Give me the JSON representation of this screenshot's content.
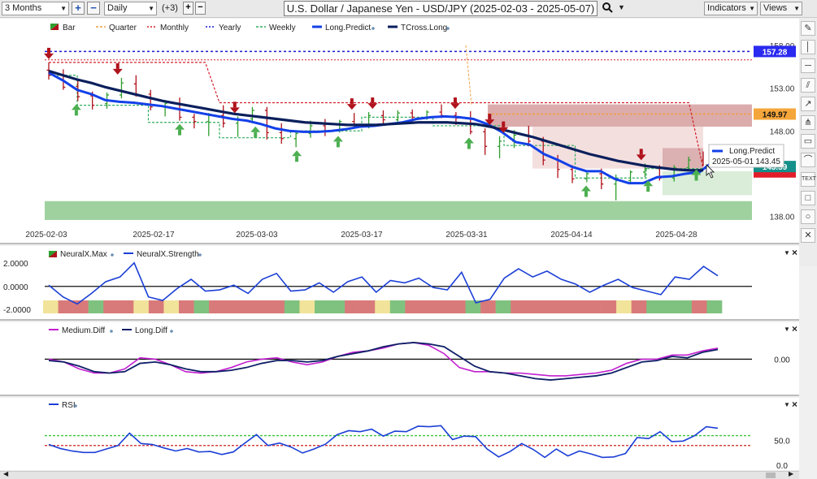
{
  "toolbar": {
    "range": "3 Months",
    "interval": "Daily",
    "plus_count": "(+3)",
    "title": "U.S. Dollar / Japanese Yen - USD/JPY (2025-02-03 - 2025-05-07)",
    "indicators_label": "Indicators",
    "views_label": "Views"
  },
  "legend": {
    "bar": "Bar",
    "quarter": "Quarter",
    "monthly": "Monthly",
    "yearly": "Yearly",
    "weekly": "Weekly",
    "long_predict": "Long.Predict",
    "tcross_long": "TCross.Long"
  },
  "colors": {
    "tcross": "#0a1f5c",
    "predict": "#1340e8",
    "up": "#2e9e2e",
    "down": "#b0121b",
    "yearly": "#1a1ad0",
    "monthly": "#d0202a",
    "quarter": "#f0a040",
    "weekly": "#2eae5a"
  },
  "tooltip": {
    "name": "Long.Predict",
    "date": "2025-05-01",
    "value": "143.45"
  },
  "price_labels": {
    "yearly": "157.28",
    "quarter": "149.97",
    "predict": "143.59",
    "monthly": "143.59"
  },
  "sidebar_icons": [
    "pencil-icon",
    "vertical-line-icon",
    "horizontal-line-icon",
    "channel-icon",
    "fibonacci-icon",
    "pitchfork-icon",
    "note-icon",
    "arc-icon",
    "text-icon",
    "rectangle-icon",
    "ellipse-icon",
    "close-icon"
  ],
  "sidebar_text": {
    "text_tool": "TEXT"
  },
  "chart_data": [
    {
      "type": "line",
      "title": "U.S. Dollar / Japanese Yen - USD/JPY (2025-02-03 - 2025-05-07)",
      "x_tick_labels": [
        "2025-02-03",
        "2025-02-17",
        "2025-03-03",
        "2025-03-17",
        "2025-03-31",
        "2025-04-14",
        "2025-04-28"
      ],
      "y_ticks": [
        138.0,
        143.0,
        148.0,
        153.0,
        158.0
      ],
      "ylim": [
        137.5,
        159.5
      ],
      "levels": {
        "yearly": 157.28,
        "quarter": 149.97,
        "monthly_recent": 143.59
      },
      "series": [
        {
          "name": "TCross.Long",
          "values": [
            155.0,
            154.5,
            154.0,
            153.6,
            153.1,
            152.7,
            152.3,
            151.9,
            151.5,
            151.2,
            150.9,
            150.6,
            150.3,
            150.0,
            149.8,
            149.6,
            149.4,
            149.2,
            149.0,
            148.9,
            148.8,
            148.7,
            148.7,
            148.7,
            148.8,
            148.9,
            149.0,
            149.0,
            149.0,
            148.9,
            148.8,
            148.5,
            148.1,
            147.7,
            147.3,
            146.8,
            146.3,
            145.8,
            145.3,
            144.9,
            144.5,
            144.2,
            143.9,
            143.7,
            143.5,
            143.4,
            143.4
          ]
        },
        {
          "name": "Long.Predict",
          "values": [
            154.8,
            153.9,
            152.8,
            152.3,
            151.6,
            151.4,
            151.3,
            151.1,
            150.9,
            150.6,
            150.3,
            150.0,
            149.7,
            149.4,
            149.2,
            148.8,
            148.3,
            148.0,
            147.9,
            147.9,
            148.0,
            148.2,
            148.5,
            148.6,
            148.8,
            149.0,
            149.4,
            149.6,
            149.7,
            149.6,
            149.4,
            148.8,
            147.9,
            146.7,
            146.4,
            145.3,
            144.6,
            143.8,
            143.3,
            143.3,
            142.4,
            141.9,
            141.9,
            142.6,
            142.7,
            143.0,
            143.2,
            144.5
          ]
        },
        {
          "name": "Weekly",
          "values": [
            154.5,
            154.5,
            151.0,
            151.0,
            151.0,
            151.0,
            151.0,
            149.0,
            149.0,
            149.0,
            149.0,
            149.0,
            147.2,
            147.2,
            147.2,
            147.2,
            147.2,
            148.0,
            148.0,
            148.0,
            148.0,
            148.0,
            149.6,
            149.6,
            149.6,
            149.6,
            149.6,
            148.6,
            148.6,
            148.6,
            148.6,
            148.6,
            146.3,
            146.3,
            146.3,
            146.3,
            146.3,
            142.5,
            142.5,
            142.5,
            142.5,
            142.5,
            143.6,
            143.6,
            143.6,
            143.6,
            143.6
          ]
        },
        {
          "name": "Monthly",
          "values": [
            156.0,
            156.0,
            156.0,
            156.0,
            156.0,
            156.0,
            156.0,
            156.0,
            156.0,
            156.0,
            156.0,
            156.0,
            151.3,
            151.3,
            151.3,
            151.3,
            151.3,
            151.3,
            151.3,
            151.3,
            151.3,
            151.3,
            151.3,
            151.3,
            151.3,
            151.3,
            151.3,
            151.3,
            151.3,
            151.3,
            151.3,
            151.3,
            151.3,
            151.3,
            151.3,
            151.3,
            151.3,
            151.3,
            151.3,
            151.3,
            151.3,
            151.3,
            151.3,
            151.3,
            151.3,
            151.3,
            143.59
          ]
        }
      ],
      "bars": [
        {
          "o": 155.1,
          "h": 156.0,
          "l": 154.0,
          "c": 154.5
        },
        {
          "o": 154.6,
          "h": 155.2,
          "l": 152.8,
          "c": 153.1
        },
        {
          "o": 153.2,
          "h": 153.9,
          "l": 151.5,
          "c": 152.0
        },
        {
          "o": 152.1,
          "h": 152.6,
          "l": 150.5,
          "c": 151.0
        },
        {
          "o": 151.2,
          "h": 152.5,
          "l": 150.6,
          "c": 152.2
        },
        {
          "o": 152.2,
          "h": 154.2,
          "l": 151.8,
          "c": 153.6
        },
        {
          "o": 153.5,
          "h": 154.5,
          "l": 152.0,
          "c": 152.3
        },
        {
          "o": 152.3,
          "h": 152.8,
          "l": 150.4,
          "c": 150.8
        },
        {
          "o": 150.8,
          "h": 151.6,
          "l": 149.7,
          "c": 151.2
        },
        {
          "o": 151.2,
          "h": 151.9,
          "l": 149.2,
          "c": 149.6
        },
        {
          "o": 149.6,
          "h": 150.0,
          "l": 148.3,
          "c": 149.1
        },
        {
          "o": 149.1,
          "h": 150.1,
          "l": 147.4,
          "c": 149.8
        },
        {
          "o": 149.8,
          "h": 151.0,
          "l": 148.4,
          "c": 148.9
        },
        {
          "o": 148.9,
          "h": 149.7,
          "l": 147.3,
          "c": 149.4
        },
        {
          "o": 149.4,
          "h": 150.8,
          "l": 148.9,
          "c": 150.4
        },
        {
          "o": 150.4,
          "h": 150.8,
          "l": 147.0,
          "c": 147.8
        },
        {
          "o": 147.8,
          "h": 148.9,
          "l": 146.5,
          "c": 147.1
        },
        {
          "o": 147.1,
          "h": 148.0,
          "l": 146.1,
          "c": 147.7
        },
        {
          "o": 147.7,
          "h": 149.2,
          "l": 147.2,
          "c": 148.6
        },
        {
          "o": 148.6,
          "h": 149.4,
          "l": 147.4,
          "c": 148.0
        },
        {
          "o": 148.0,
          "h": 149.3,
          "l": 147.8,
          "c": 149.1
        },
        {
          "o": 149.1,
          "h": 150.1,
          "l": 148.3,
          "c": 148.7
        },
        {
          "o": 148.7,
          "h": 150.2,
          "l": 148.3,
          "c": 149.8
        },
        {
          "o": 149.8,
          "h": 150.4,
          "l": 148.7,
          "c": 149.3
        },
        {
          "o": 149.3,
          "h": 150.4,
          "l": 149.1,
          "c": 150.1
        },
        {
          "o": 150.1,
          "h": 150.5,
          "l": 149.0,
          "c": 149.6
        },
        {
          "o": 149.6,
          "h": 150.4,
          "l": 149.3,
          "c": 150.2
        },
        {
          "o": 150.2,
          "h": 151.1,
          "l": 149.5,
          "c": 149.8
        },
        {
          "o": 149.8,
          "h": 150.2,
          "l": 148.7,
          "c": 149.5
        },
        {
          "o": 149.5,
          "h": 150.3,
          "l": 147.6,
          "c": 147.9
        },
        {
          "o": 147.9,
          "h": 148.3,
          "l": 145.2,
          "c": 146.2
        },
        {
          "o": 146.2,
          "h": 147.4,
          "l": 144.8,
          "c": 146.8
        },
        {
          "o": 146.8,
          "h": 148.1,
          "l": 146.0,
          "c": 147.5
        },
        {
          "o": 147.5,
          "h": 148.6,
          "l": 146.2,
          "c": 146.8
        },
        {
          "o": 146.8,
          "h": 147.3,
          "l": 144.0,
          "c": 144.6
        },
        {
          "o": 144.6,
          "h": 145.2,
          "l": 142.5,
          "c": 143.5
        },
        {
          "o": 143.5,
          "h": 144.0,
          "l": 141.9,
          "c": 142.4
        },
        {
          "o": 142.4,
          "h": 143.3,
          "l": 142.0,
          "c": 143.0
        },
        {
          "o": 143.0,
          "h": 143.6,
          "l": 141.2,
          "c": 141.8
        },
        {
          "o": 141.8,
          "h": 142.9,
          "l": 139.9,
          "c": 142.2
        },
        {
          "o": 142.2,
          "h": 143.4,
          "l": 141.8,
          "c": 143.2
        },
        {
          "o": 143.2,
          "h": 144.2,
          "l": 142.6,
          "c": 143.6
        },
        {
          "o": 143.6,
          "h": 144.0,
          "l": 142.2,
          "c": 142.5
        },
        {
          "o": 142.5,
          "h": 144.0,
          "l": 142.1,
          "c": 143.7
        },
        {
          "o": 143.7,
          "h": 145.0,
          "l": 143.3,
          "c": 144.6
        },
        {
          "o": 144.6,
          "h": 145.6,
          "l": 143.9,
          "c": 143.6
        }
      ],
      "signals": {
        "down_idx": [
          0,
          10,
          27,
          44,
          47,
          59,
          64,
          66,
          86
        ],
        "up_idx": [
          4,
          19,
          30,
          36,
          42,
          61,
          78,
          87,
          94
        ]
      }
    },
    {
      "type": "line",
      "series": [
        {
          "name": "NeuralX.Max",
          "values": []
        },
        {
          "name": "NeuralX.Strength",
          "values": [
            0.1,
            -0.9,
            -1.5,
            -0.6,
            0.4,
            0.8,
            2.0,
            -0.9,
            -1.2,
            -0.2,
            0.6,
            -0.4,
            -0.3,
            0.1,
            -0.6,
            0.6,
            1.1,
            -0.4,
            -0.3,
            0.3,
            -0.5,
            0.4,
            0.8,
            -0.5,
            0.5,
            0.3,
            0.7,
            -0.1,
            -0.3,
            1.2,
            -1.4,
            -1.1,
            0.7,
            1.5,
            0.8,
            1.3,
            0.6,
            0.2,
            -0.5,
            0.1,
            0.6,
            -0.1,
            -0.4,
            -0.7,
            0.8,
            0.6,
            1.7,
            0.9
          ]
        }
      ],
      "y_tick_labels": [
        "2.0000",
        "0.0000",
        "-2.0000"
      ],
      "ylim": [
        -2.3,
        2.4
      ],
      "regime_colors": [
        "y",
        "r",
        "r",
        "g",
        "r",
        "r",
        "y",
        "r",
        "y",
        "r",
        "g",
        "r",
        "r",
        "r",
        "r",
        "r",
        "g",
        "y",
        "g",
        "g",
        "r",
        "r",
        "y",
        "g",
        "r",
        "r",
        "r",
        "r",
        "g",
        "r",
        "g",
        "r",
        "r",
        "r",
        "r",
        "r",
        "r",
        "r",
        "y",
        "r",
        "g",
        "g",
        "g",
        "r",
        "g"
      ]
    },
    {
      "type": "line",
      "series": [
        {
          "name": "Medium.Diff",
          "values": [
            0.0,
            -0.2,
            -0.7,
            -1.0,
            -1.0,
            -0.7,
            0.1,
            0.0,
            -0.4,
            -0.9,
            -1.0,
            -0.9,
            -0.6,
            -0.2,
            0.0,
            0.1,
            -0.2,
            -0.4,
            -0.2,
            0.2,
            0.5,
            0.6,
            0.8,
            1.1,
            1.2,
            1.0,
            0.4,
            -0.6,
            -0.9,
            -0.9,
            -1.0,
            -1.0,
            -1.1,
            -1.2,
            -1.2,
            -1.1,
            -1.0,
            -0.8,
            -0.3,
            0.0,
            0.0,
            0.3,
            0.3,
            0.6,
            0.8
          ]
        },
        {
          "name": "Long.Diff",
          "values": [
            -0.1,
            -0.2,
            -0.5,
            -0.9,
            -1.0,
            -0.9,
            -0.3,
            -0.2,
            -0.4,
            -0.7,
            -0.9,
            -0.9,
            -0.8,
            -0.6,
            -0.3,
            -0.1,
            -0.1,
            -0.2,
            -0.1,
            0.2,
            0.4,
            0.6,
            0.9,
            1.1,
            1.2,
            1.1,
            0.9,
            0.2,
            -0.5,
            -0.9,
            -1.0,
            -1.2,
            -1.4,
            -1.5,
            -1.4,
            -1.3,
            -1.2,
            -1.0,
            -0.6,
            -0.2,
            -0.1,
            0.2,
            0.1,
            0.5,
            0.7
          ]
        }
      ],
      "y_tick_labels": [
        "0.00"
      ],
      "ylim": [
        -2.2,
        1.9
      ]
    },
    {
      "type": "line",
      "series": [
        {
          "name": "RSI",
          "values": [
            42,
            34,
            29,
            26,
            26,
            33,
            40,
            65,
            44,
            42,
            35,
            29,
            34,
            27,
            28,
            22,
            27,
            45,
            62,
            40,
            45,
            37,
            25,
            33,
            43,
            62,
            70,
            68,
            73,
            59,
            69,
            68,
            79,
            78,
            80,
            52,
            59,
            58,
            33,
            17,
            28,
            44,
            32,
            16,
            33,
            19,
            29,
            23,
            16,
            17,
            24,
            56,
            54,
            68,
            48,
            49,
            60,
            78,
            75
          ]
        }
      ],
      "y_tick_labels": [
        "50.0",
        "0.0"
      ],
      "ylim": [
        -3,
        115
      ],
      "levels": {
        "overbought": 60,
        "oversold": 40
      }
    }
  ]
}
